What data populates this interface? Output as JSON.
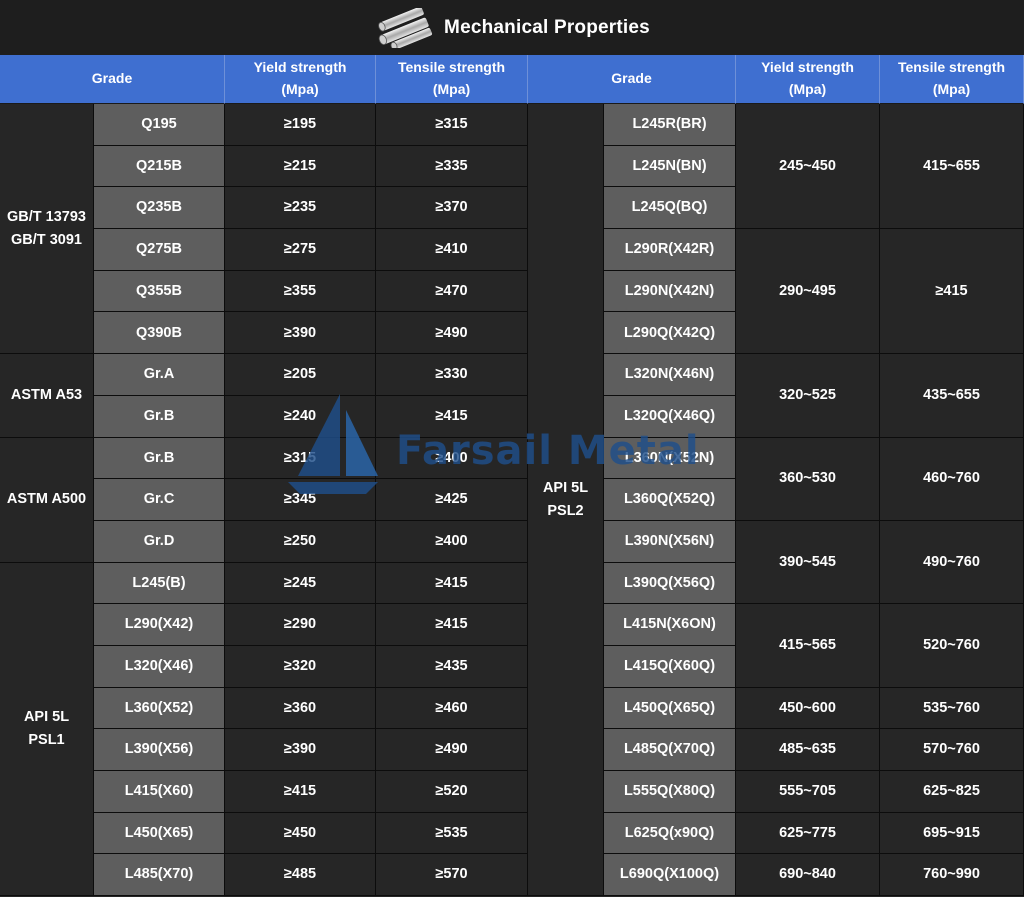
{
  "title": "Mechanical Properties",
  "header": {
    "grade": "Grade",
    "yield": "Yield strength\n(Mpa)",
    "tensile": "Tensile strength\n(Mpa)"
  },
  "left_groups": [
    {
      "label": "GB/T 13793\nGB/T 3091",
      "rows": [
        {
          "grade": "Q195",
          "yield": "≥195",
          "tensile": "≥315"
        },
        {
          "grade": "Q215B",
          "yield": "≥215",
          "tensile": "≥335"
        },
        {
          "grade": "Q235B",
          "yield": "≥235",
          "tensile": "≥370"
        },
        {
          "grade": "Q275B",
          "yield": "≥275",
          "tensile": "≥410"
        },
        {
          "grade": "Q355B",
          "yield": "≥355",
          "tensile": "≥470"
        },
        {
          "grade": "Q390B",
          "yield": "≥390",
          "tensile": "≥490"
        }
      ]
    },
    {
      "label": "ASTM A53",
      "rows": [
        {
          "grade": "Gr.A",
          "yield": "≥205",
          "tensile": "≥330"
        },
        {
          "grade": "Gr.B",
          "yield": "≥240",
          "tensile": "≥415"
        }
      ]
    },
    {
      "label": "ASTM A500",
      "rows": [
        {
          "grade": "Gr.B",
          "yield": "≥315",
          "tensile": "≥400"
        },
        {
          "grade": "Gr.C",
          "yield": "≥345",
          "tensile": "≥425"
        },
        {
          "grade": "Gr.D",
          "yield": "≥250",
          "tensile": "≥400"
        }
      ]
    },
    {
      "label": "API 5L\nPSL1",
      "rows": [
        {
          "grade": "L245(B)",
          "yield": "≥245",
          "tensile": "≥415"
        },
        {
          "grade": "L290(X42)",
          "yield": "≥290",
          "tensile": "≥415"
        },
        {
          "grade": "L320(X46)",
          "yield": "≥320",
          "tensile": "≥435"
        },
        {
          "grade": "L360(X52)",
          "yield": "≥360",
          "tensile": "≥460"
        },
        {
          "grade": "L390(X56)",
          "yield": "≥390",
          "tensile": "≥490"
        },
        {
          "grade": "L415(X60)",
          "yield": "≥415",
          "tensile": "≥520"
        },
        {
          "grade": "L450(X65)",
          "yield": "≥450",
          "tensile": "≥535"
        },
        {
          "grade": "L485(X70)",
          "yield": "≥485",
          "tensile": "≥570"
        }
      ]
    }
  ],
  "right_group_label": "API 5L\nPSL2",
  "right_grades": [
    "L245R(BR)",
    "L245N(BN)",
    "L245Q(BQ)",
    "L290R(X42R)",
    "L290N(X42N)",
    "L290Q(X42Q)",
    "L320N(X46N)",
    "L320Q(X46Q)",
    "L360N(X52N)",
    "L360Q(X52Q)",
    "L390N(X56N)",
    "L390Q(X56Q)",
    "L415N(X6ON)",
    "L415Q(X60Q)",
    "L450Q(X65Q)",
    "L485Q(X70Q)",
    "L555Q(X80Q)",
    "L625Q(x90Q)",
    "L690Q(X100Q)"
  ],
  "right_values": [
    {
      "span": 3,
      "yield": "245~450",
      "tensile": "415~655"
    },
    {
      "span": 3,
      "yield": "290~495",
      "tensile": "≥415"
    },
    {
      "span": 2,
      "yield": "320~525",
      "tensile": "435~655"
    },
    {
      "span": 2,
      "yield": "360~530",
      "tensile": "460~760"
    },
    {
      "span": 2,
      "yield": "390~545",
      "tensile": "490~760"
    },
    {
      "span": 2,
      "yield": "415~565",
      "tensile": "520~760"
    },
    {
      "span": 1,
      "yield": "450~600",
      "tensile": "535~760"
    },
    {
      "span": 1,
      "yield": "485~635",
      "tensile": "570~760"
    },
    {
      "span": 1,
      "yield": "555~705",
      "tensile": "625~825"
    },
    {
      "span": 1,
      "yield": "625~775",
      "tensile": "695~915"
    },
    {
      "span": 1,
      "yield": "690~840",
      "tensile": "760~990"
    }
  ],
  "watermark": "Farsail Metal",
  "colors": {
    "header_blue": "#3f6fd0",
    "grade_gray": "#5e5e5e",
    "background": "#252525",
    "watermark": "#1f4f8a"
  },
  "icons": {
    "title_icon": "steel-pipes-icon",
    "watermark_icon": "sailboat-icon"
  }
}
